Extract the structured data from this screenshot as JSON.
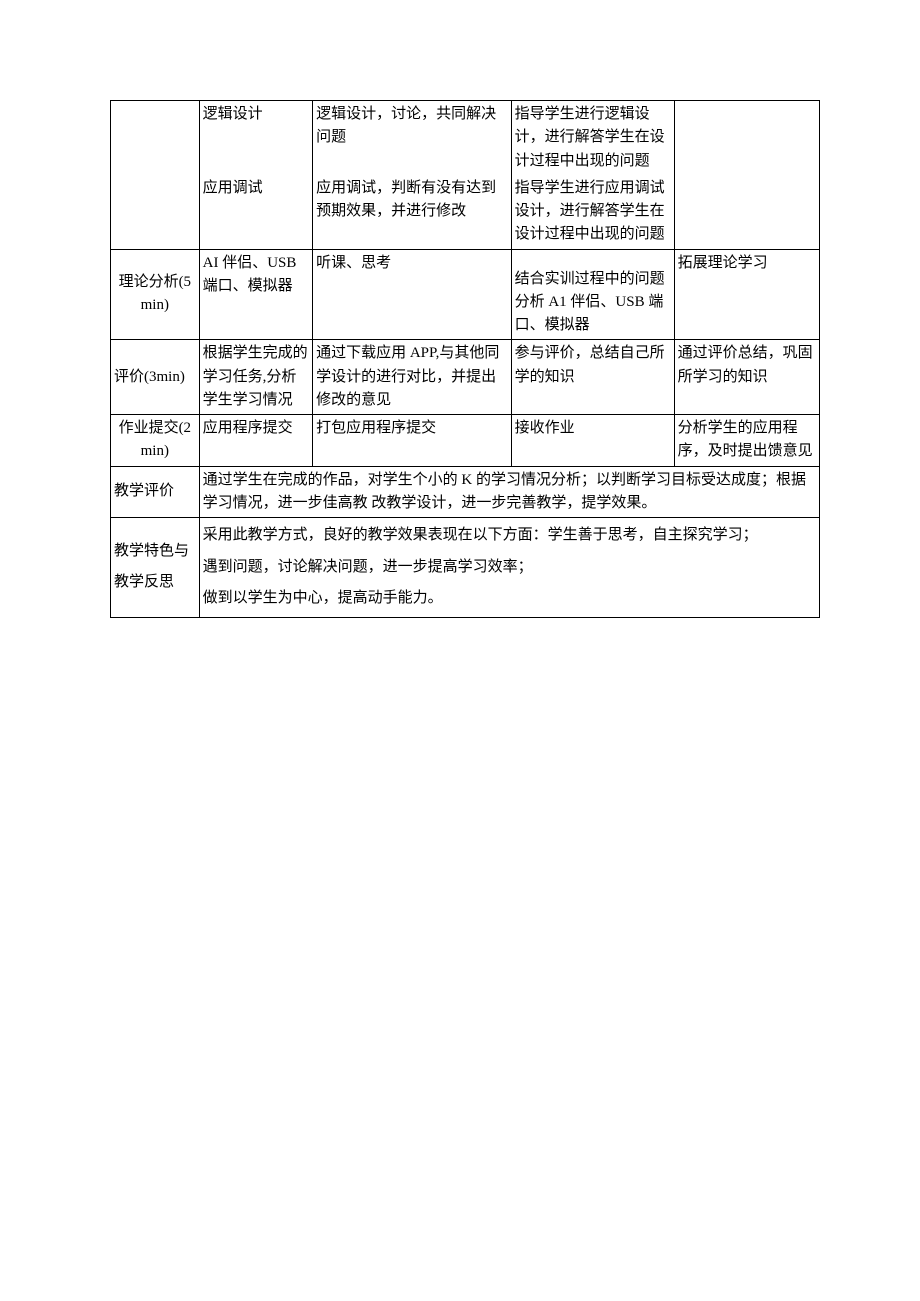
{
  "r1": {
    "c2": "逻辑设计",
    "c3": "逻辑设计，讨论，共同解决问题",
    "c4": "指导学生进行逻辑设计，进行解答学生在设计过程中出现的问题"
  },
  "r2": {
    "c2": "应用调试",
    "c3": "应用调试，判断有没有达到预期效果，并进行修改",
    "c4": "指导学生进行应用调试设计，进行解答学生在设计过程中出现的问题\n"
  },
  "r3": {
    "c1": "理论分析(5min)",
    "c2": "AI 伴侣、USB 端口、模拟器",
    "c3": "听课、思考",
    "c4": "结合实训过程中的问题分析 A1 伴侣、USB 端口、模拟器",
    "c5": "拓展理论学习"
  },
  "r4": {
    "c1": "评价(3min)",
    "c2": "根据学生完成的学习任务,分析学生学习情况",
    "c3": "通过下载应用 APP,与其他同学设计的进行对比，并提出修改的意见",
    "c4": "参与评价，总结自己所学的知识",
    "c5": "通过评价总结，巩固所学习的知识"
  },
  "r5": {
    "c1": "作业提交(2min)",
    "c2": "应用程序提交",
    "c3": "打包应用程序提交",
    "c4": "接收作业",
    "c5": "分析学生的应用程序，及时提出馈意见"
  },
  "r6": {
    "c1": "教学评价",
    "merged": "通过学生在完成的作品，对学生个小的 K 的学习情况分析；以判断学习目标受达成度；根据学习情况，进一步佳高教 改教学设计，进一步完善教学，提学效果。"
  },
  "r7": {
    "c1": "教学特色与教学反思",
    "p1": "采用此教学方式，良好的教学效果表现在以下方面：学生善于思考，自主探究学习；",
    "p2": "遇到问题，讨论解决问题，进一步提高学习效率；",
    "p3": "做到以学生为中心，提高动手能力。"
  }
}
